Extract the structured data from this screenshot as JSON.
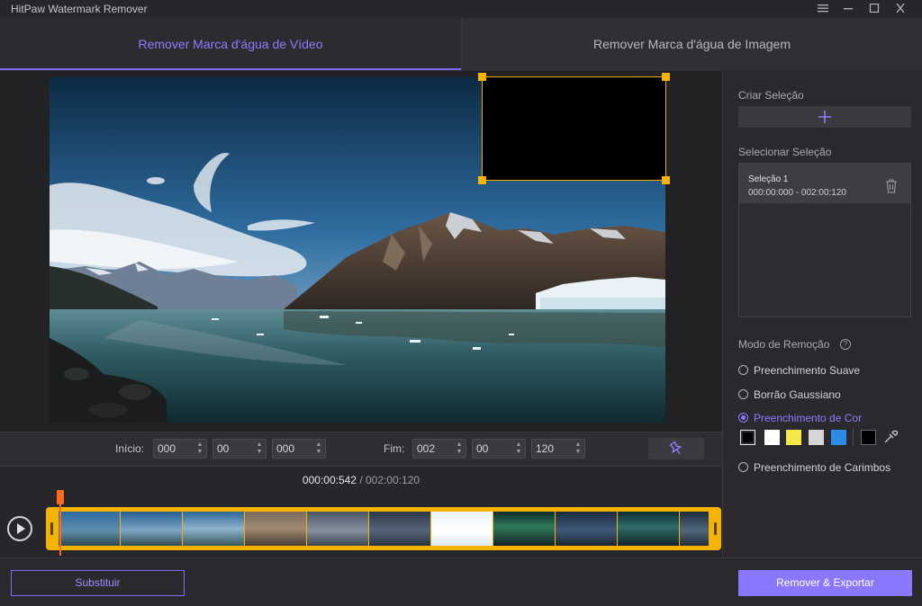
{
  "app": {
    "title": "HitPaw Watermark Remover"
  },
  "tabs": [
    {
      "label": "Remover Marca d'água de Vídeo",
      "active": true
    },
    {
      "label": "Remover Marca d'água de Imagem",
      "active": false
    }
  ],
  "time_controls": {
    "start_label": "Início:",
    "start": [
      "000",
      "00",
      "000"
    ],
    "end_label": "Fim:",
    "end": [
      "002",
      "00",
      "120"
    ]
  },
  "timeline": {
    "current": "000:00:542",
    "separator": " / ",
    "total": "002:00:120"
  },
  "panel": {
    "create_label": "Criar Seleção",
    "select_label": "Selecionar Seleção",
    "selections": [
      {
        "name": "Seleção 1",
        "range": "000:00:000 - 002:00:120"
      }
    ],
    "mode_label": "Modo de Remoção",
    "modes": [
      {
        "label": "Preenchimento Suave",
        "selected": false
      },
      {
        "label": "Borrão Gaussiano",
        "selected": false
      },
      {
        "label": "Preenchimento de Cor",
        "selected": true
      },
      {
        "label": "Preenchimento de Carimbos",
        "selected": false
      }
    ],
    "colors": [
      "#000000",
      "#ffffff",
      "#f5e94a",
      "#d6d6d6",
      "#2b8be6"
    ],
    "custom_color": "#000000"
  },
  "buttons": {
    "replace": "Substituir",
    "export": "Remover & Exportar"
  },
  "accent": "#8a77ff",
  "selection_color": "#f5b400"
}
